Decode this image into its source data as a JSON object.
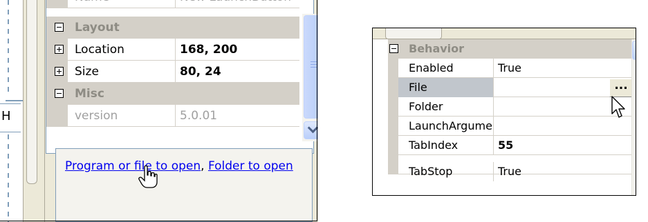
{
  "left_panel": {
    "designer_letter": "H",
    "partial_top_row": {
      "name": "Name",
      "value": "New LaunchButton"
    },
    "categories": [
      {
        "label": "Layout",
        "expanded": true
      },
      {
        "label": "Misc",
        "expanded": true
      }
    ],
    "properties": {
      "location": {
        "name": "Location",
        "value": "168, 200"
      },
      "size": {
        "name": "Size",
        "value": "80, 24"
      },
      "version": {
        "name": "version",
        "value": "5.0.01"
      }
    },
    "description": {
      "link1": "Program or file to open",
      "separator": ", ",
      "link2": "Folder to open"
    }
  },
  "right_panel": {
    "category": "Behavior",
    "rows": [
      {
        "name": "Enabled",
        "value": "True"
      },
      {
        "name": "File",
        "value": "",
        "selected": true,
        "button": "..."
      },
      {
        "name": "Folder",
        "value": ""
      },
      {
        "name": "LaunchArgume",
        "value": ""
      },
      {
        "name": "TabIndex",
        "value": "55",
        "bold": true
      },
      {
        "name": "TabStop",
        "value": "True"
      }
    ]
  },
  "icons": {
    "collapse": "minus-box-icon",
    "expand": "plus-box-icon",
    "cursor_hand": "hand-pointer-icon",
    "cursor_arrow": "arrow-pointer-icon"
  }
}
